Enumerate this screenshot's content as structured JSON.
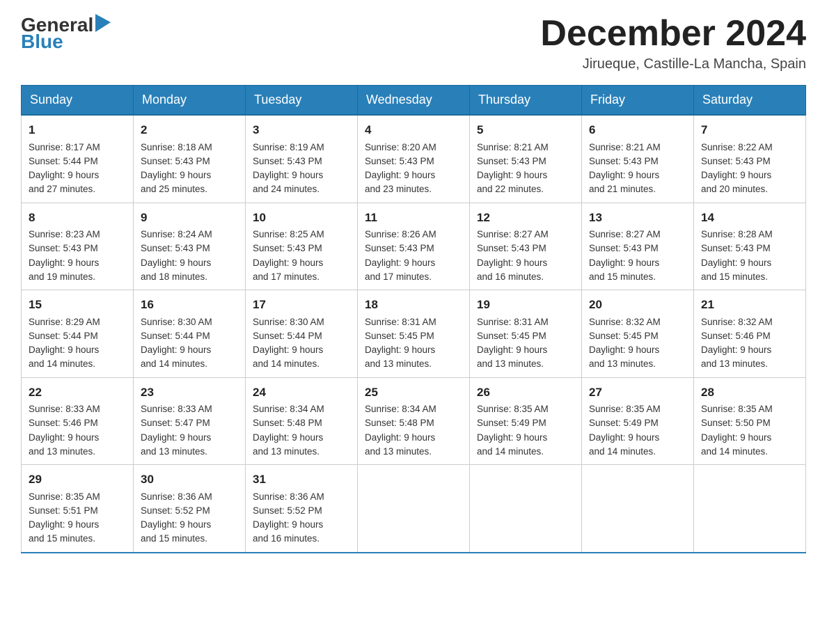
{
  "header": {
    "month_title": "December 2024",
    "location": "Jirueque, Castille-La Mancha, Spain",
    "logo_general": "General",
    "logo_blue": "Blue"
  },
  "weekdays": [
    "Sunday",
    "Monday",
    "Tuesday",
    "Wednesday",
    "Thursday",
    "Friday",
    "Saturday"
  ],
  "weeks": [
    [
      {
        "day": "1",
        "sunrise": "8:17 AM",
        "sunset": "5:44 PM",
        "daylight": "9 hours and 27 minutes."
      },
      {
        "day": "2",
        "sunrise": "8:18 AM",
        "sunset": "5:43 PM",
        "daylight": "9 hours and 25 minutes."
      },
      {
        "day": "3",
        "sunrise": "8:19 AM",
        "sunset": "5:43 PM",
        "daylight": "9 hours and 24 minutes."
      },
      {
        "day": "4",
        "sunrise": "8:20 AM",
        "sunset": "5:43 PM",
        "daylight": "9 hours and 23 minutes."
      },
      {
        "day": "5",
        "sunrise": "8:21 AM",
        "sunset": "5:43 PM",
        "daylight": "9 hours and 22 minutes."
      },
      {
        "day": "6",
        "sunrise": "8:21 AM",
        "sunset": "5:43 PM",
        "daylight": "9 hours and 21 minutes."
      },
      {
        "day": "7",
        "sunrise": "8:22 AM",
        "sunset": "5:43 PM",
        "daylight": "9 hours and 20 minutes."
      }
    ],
    [
      {
        "day": "8",
        "sunrise": "8:23 AM",
        "sunset": "5:43 PM",
        "daylight": "9 hours and 19 minutes."
      },
      {
        "day": "9",
        "sunrise": "8:24 AM",
        "sunset": "5:43 PM",
        "daylight": "9 hours and 18 minutes."
      },
      {
        "day": "10",
        "sunrise": "8:25 AM",
        "sunset": "5:43 PM",
        "daylight": "9 hours and 17 minutes."
      },
      {
        "day": "11",
        "sunrise": "8:26 AM",
        "sunset": "5:43 PM",
        "daylight": "9 hours and 17 minutes."
      },
      {
        "day": "12",
        "sunrise": "8:27 AM",
        "sunset": "5:43 PM",
        "daylight": "9 hours and 16 minutes."
      },
      {
        "day": "13",
        "sunrise": "8:27 AM",
        "sunset": "5:43 PM",
        "daylight": "9 hours and 15 minutes."
      },
      {
        "day": "14",
        "sunrise": "8:28 AM",
        "sunset": "5:43 PM",
        "daylight": "9 hours and 15 minutes."
      }
    ],
    [
      {
        "day": "15",
        "sunrise": "8:29 AM",
        "sunset": "5:44 PM",
        "daylight": "9 hours and 14 minutes."
      },
      {
        "day": "16",
        "sunrise": "8:30 AM",
        "sunset": "5:44 PM",
        "daylight": "9 hours and 14 minutes."
      },
      {
        "day": "17",
        "sunrise": "8:30 AM",
        "sunset": "5:44 PM",
        "daylight": "9 hours and 14 minutes."
      },
      {
        "day": "18",
        "sunrise": "8:31 AM",
        "sunset": "5:45 PM",
        "daylight": "9 hours and 13 minutes."
      },
      {
        "day": "19",
        "sunrise": "8:31 AM",
        "sunset": "5:45 PM",
        "daylight": "9 hours and 13 minutes."
      },
      {
        "day": "20",
        "sunrise": "8:32 AM",
        "sunset": "5:45 PM",
        "daylight": "9 hours and 13 minutes."
      },
      {
        "day": "21",
        "sunrise": "8:32 AM",
        "sunset": "5:46 PM",
        "daylight": "9 hours and 13 minutes."
      }
    ],
    [
      {
        "day": "22",
        "sunrise": "8:33 AM",
        "sunset": "5:46 PM",
        "daylight": "9 hours and 13 minutes."
      },
      {
        "day": "23",
        "sunrise": "8:33 AM",
        "sunset": "5:47 PM",
        "daylight": "9 hours and 13 minutes."
      },
      {
        "day": "24",
        "sunrise": "8:34 AM",
        "sunset": "5:48 PM",
        "daylight": "9 hours and 13 minutes."
      },
      {
        "day": "25",
        "sunrise": "8:34 AM",
        "sunset": "5:48 PM",
        "daylight": "9 hours and 13 minutes."
      },
      {
        "day": "26",
        "sunrise": "8:35 AM",
        "sunset": "5:49 PM",
        "daylight": "9 hours and 14 minutes."
      },
      {
        "day": "27",
        "sunrise": "8:35 AM",
        "sunset": "5:49 PM",
        "daylight": "9 hours and 14 minutes."
      },
      {
        "day": "28",
        "sunrise": "8:35 AM",
        "sunset": "5:50 PM",
        "daylight": "9 hours and 14 minutes."
      }
    ],
    [
      {
        "day": "29",
        "sunrise": "8:35 AM",
        "sunset": "5:51 PM",
        "daylight": "9 hours and 15 minutes."
      },
      {
        "day": "30",
        "sunrise": "8:36 AM",
        "sunset": "5:52 PM",
        "daylight": "9 hours and 15 minutes."
      },
      {
        "day": "31",
        "sunrise": "8:36 AM",
        "sunset": "5:52 PM",
        "daylight": "9 hours and 16 minutes."
      },
      null,
      null,
      null,
      null
    ]
  ],
  "labels": {
    "sunrise": "Sunrise:",
    "sunset": "Sunset:",
    "daylight": "Daylight:"
  }
}
